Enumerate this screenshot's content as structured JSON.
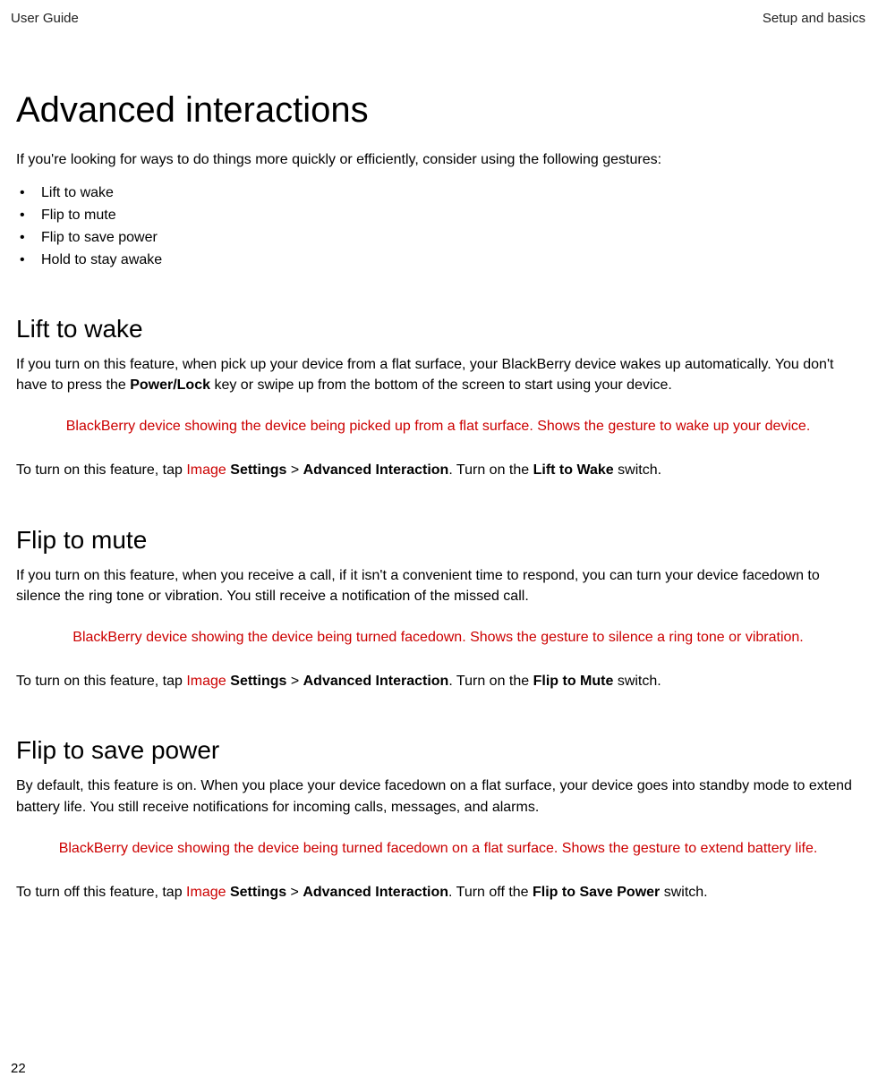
{
  "header": {
    "left": "User Guide",
    "right": "Setup and basics"
  },
  "title": "Advanced interactions",
  "intro": "If you're looking for ways to do things more quickly or efficiently, consider using the following gestures:",
  "bullets": [
    "Lift to wake",
    "Flip to mute",
    "Flip to save power",
    "Hold to stay awake"
  ],
  "sections": [
    {
      "heading": "Lift to wake",
      "body_pre": "If you turn on this feature, when pick up your device from a flat surface, your BlackBerry device wakes up automatically. You don't have to press the ",
      "body_bold": "Power/Lock",
      "body_post": " key or swipe up from the bottom of the screen to start using your device.",
      "caption": "BlackBerry device showing the device being picked up from a flat surface. Shows the gesture to wake up your device.",
      "instr_pre": "To turn on this feature, tap ",
      "instr_img": " Image ",
      "instr_settings": " Settings",
      "instr_gt": " > ",
      "instr_advanced": "Advanced Interaction",
      "instr_mid": ". Turn on the ",
      "instr_switch": "Lift to Wake",
      "instr_end": " switch."
    },
    {
      "heading": "Flip to mute",
      "body_pre": "If you turn on this feature, when you receive a call, if it isn't a convenient time to respond, you can turn your device facedown to silence the ring tone or vibration. You still receive a notification of the missed call.",
      "body_bold": "",
      "body_post": "",
      "caption": "BlackBerry device showing the device being turned facedown. Shows the gesture to silence a ring tone or vibration.",
      "instr_pre": "To turn on this feature, tap ",
      "instr_img": " Image ",
      "instr_settings": " Settings",
      "instr_gt": " > ",
      "instr_advanced": "Advanced Interaction",
      "instr_mid": ". Turn on the ",
      "instr_switch": "Flip to Mute",
      "instr_end": " switch."
    },
    {
      "heading": "Flip to save power",
      "body_pre": "By default, this feature is on. When you place your device facedown on a flat surface, your device goes into standby mode to extend battery life. You still receive notifications for incoming calls, messages, and alarms.",
      "body_bold": "",
      "body_post": "",
      "caption": "BlackBerry device showing the device being turned facedown on a flat surface. Shows the gesture to extend battery life.",
      "instr_pre": "To turn off this feature, tap ",
      "instr_img": " Image ",
      "instr_settings": " Settings",
      "instr_gt": " > ",
      "instr_advanced": "Advanced Interaction",
      "instr_mid": ". Turn off the ",
      "instr_switch": "Flip to Save Power",
      "instr_end": " switch."
    }
  ],
  "page_number": "22"
}
